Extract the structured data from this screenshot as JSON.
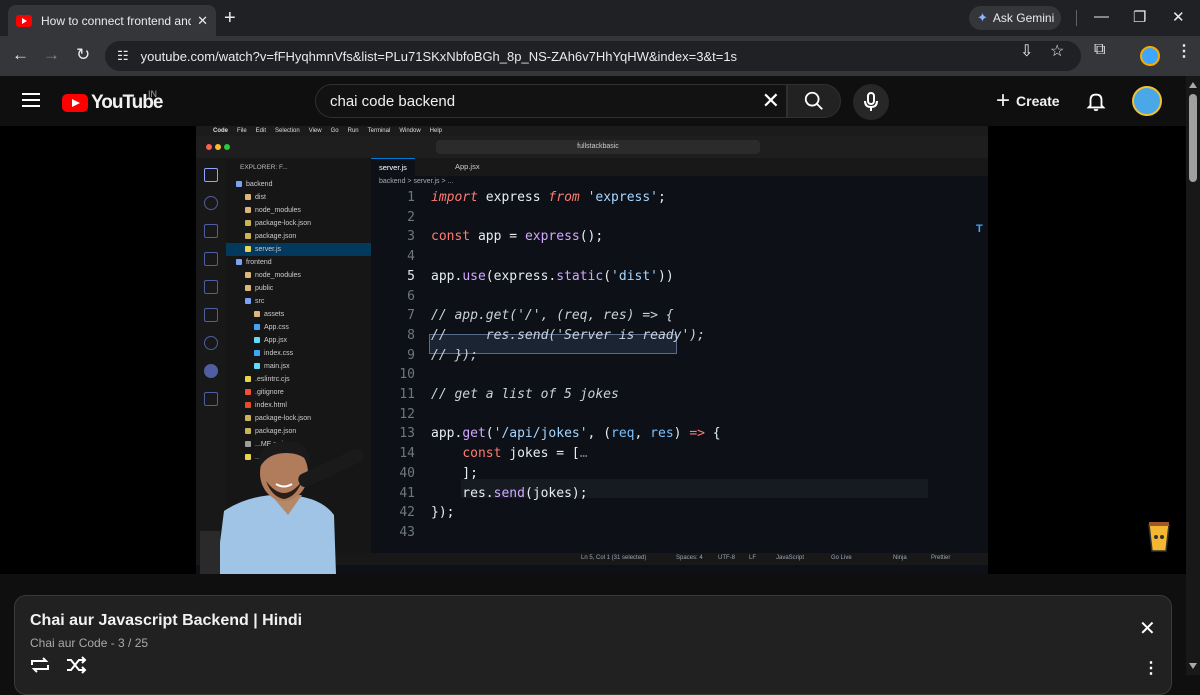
{
  "browser": {
    "tab_title": "How to connect frontend and b",
    "tab_close": "✕",
    "new_tab": "+",
    "ask_gemini": "Ask Gemini",
    "url": "youtube.com/watch?v=fFHyqhmnVfs&list=PLu71SKxNbfoBGh_8p_NS-ZAh6v7HhYqHW&index=3&t=1s"
  },
  "youtube": {
    "logo_text": "YouTube",
    "region": "IN",
    "search_value": "chai code backend",
    "create_label": "Create"
  },
  "video": {
    "vscode": {
      "menubar": [
        "Code",
        "File",
        "Edit",
        "Selection",
        "View",
        "Go",
        "Run",
        "Terminal",
        "Window",
        "Help"
      ],
      "command_center": "fullstackbasic",
      "explorer_title": "EXPLORER: F...",
      "tree": [
        {
          "label": "backend",
          "indent": 0,
          "kind": "folder-open"
        },
        {
          "label": "dist",
          "indent": 1,
          "kind": "folder"
        },
        {
          "label": "node_modules",
          "indent": 1,
          "kind": "folder"
        },
        {
          "label": "package-lock.json",
          "indent": 1,
          "kind": "json"
        },
        {
          "label": "package.json",
          "indent": 1,
          "kind": "json"
        },
        {
          "label": "server.js",
          "indent": 1,
          "kind": "js",
          "selected": true
        },
        {
          "label": "frontend",
          "indent": 0,
          "kind": "folder-open"
        },
        {
          "label": "node_modules",
          "indent": 1,
          "kind": "folder"
        },
        {
          "label": "public",
          "indent": 1,
          "kind": "folder"
        },
        {
          "label": "src",
          "indent": 1,
          "kind": "folder-open"
        },
        {
          "label": "assets",
          "indent": 2,
          "kind": "folder"
        },
        {
          "label": "App.css",
          "indent": 2,
          "kind": "css"
        },
        {
          "label": "App.jsx",
          "indent": 2,
          "kind": "react"
        },
        {
          "label": "index.css",
          "indent": 2,
          "kind": "css"
        },
        {
          "label": "main.jsx",
          "indent": 2,
          "kind": "react"
        },
        {
          "label": ".eslintrc.cjs",
          "indent": 1,
          "kind": "js"
        },
        {
          "label": ".gitignore",
          "indent": 1,
          "kind": "git"
        },
        {
          "label": "index.html",
          "indent": 1,
          "kind": "html"
        },
        {
          "label": "package-lock.json",
          "indent": 1,
          "kind": "json"
        },
        {
          "label": "package.json",
          "indent": 1,
          "kind": "json"
        },
        {
          "label": "...ME.md",
          "indent": 1,
          "kind": "md"
        },
        {
          "label": "...nfig.js",
          "indent": 1,
          "kind": "js"
        }
      ],
      "tabs": [
        "server.js",
        "App.jsx"
      ],
      "breadcrumb": "backend > server.js > ...",
      "line_numbers": [
        "1",
        "2",
        "3",
        "4",
        "5",
        "6",
        "7",
        "8",
        "9",
        "10",
        "11",
        "12",
        "13",
        "14",
        "40",
        "41",
        "42",
        "43"
      ],
      "status": {
        "cursor": "Ln 5, Col 1 (31 selected)",
        "spaces": "Spaces: 4",
        "encoding": "UTF-8",
        "eol": "LF",
        "language": "JavaScript",
        "golive": "Go Live",
        "ninja": "Ninja",
        "prettier": "Prettier"
      }
    },
    "side_letter": "T"
  },
  "playlist": {
    "title": "Chai aur Javascript Backend | Hindi",
    "subtitle": "Chai aur Code - 3 / 25",
    "close": "✕",
    "more": "⋮"
  },
  "colors": {
    "youtube_red": "#ff0000",
    "keyword": "#ff7b72",
    "string": "#a5d6ff",
    "function": "#d2a8ff"
  }
}
